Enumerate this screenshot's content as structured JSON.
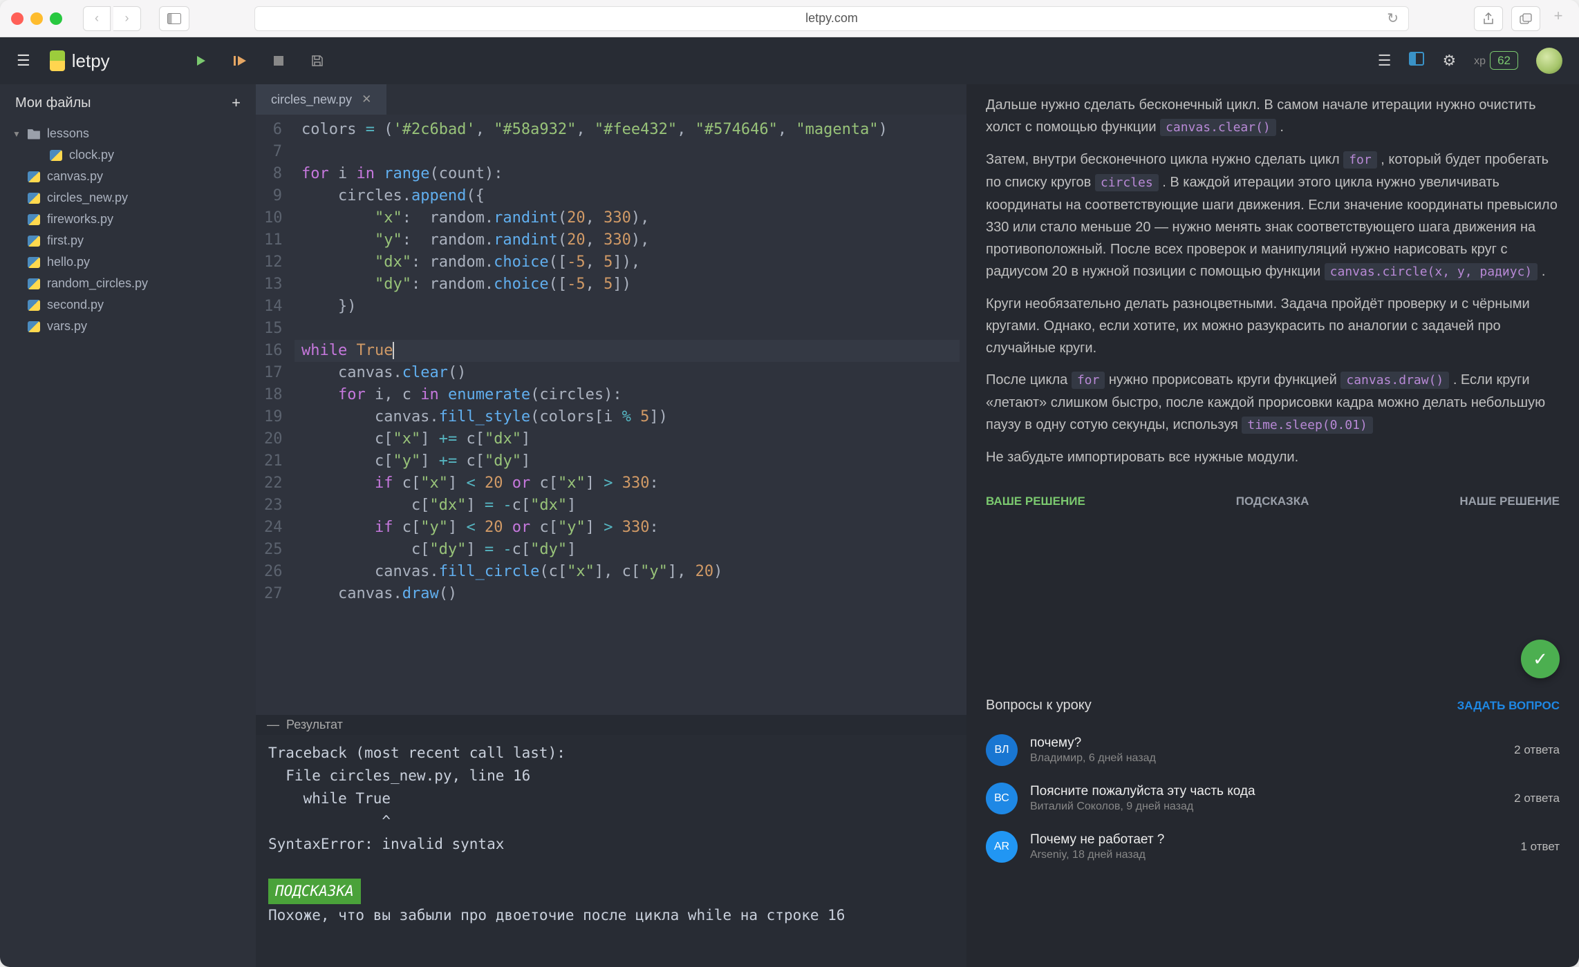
{
  "browser": {
    "url": "letpy.com"
  },
  "header": {
    "brand": "letpy",
    "xp_label": "xp",
    "xp_value": "62"
  },
  "filepanel": {
    "title": "Мои файлы",
    "folder": "lessons",
    "folder_child": "clock.py",
    "files": [
      "canvas.py",
      "circles_new.py",
      "fireworks.py",
      "first.py",
      "hello.py",
      "random_circles.py",
      "second.py",
      "vars.py"
    ]
  },
  "editor": {
    "tab_name": "circles_new.py",
    "gutter_start": 6,
    "lines": [
      {
        "n": 6,
        "html": "colors <span class='tk-op'>=</span> (<span class='tk-str'>'#2c6bad'</span>, <span class='tk-str'>\"#58a932\"</span>, <span class='tk-str'>\"#fee432\"</span>, <span class='tk-str'>\"#574646\"</span>, <span class='tk-str'>\"magenta\"</span>)"
      },
      {
        "n": 7,
        "html": ""
      },
      {
        "n": 8,
        "html": "<span class='tk-kw'>for</span> i <span class='tk-kw'>in</span> <span class='tk-fn'>range</span>(count):"
      },
      {
        "n": 9,
        "html": "    circles.<span class='tk-fn'>append</span>({"
      },
      {
        "n": 10,
        "html": "        <span class='tk-str'>\"x\"</span>:  random.<span class='tk-fn'>randint</span>(<span class='tk-num'>20</span>, <span class='tk-num'>330</span>),"
      },
      {
        "n": 11,
        "html": "        <span class='tk-str'>\"y\"</span>:  random.<span class='tk-fn'>randint</span>(<span class='tk-num'>20</span>, <span class='tk-num'>330</span>),"
      },
      {
        "n": 12,
        "html": "        <span class='tk-str'>\"dx\"</span>: random.<span class='tk-fn'>choice</span>([<span class='tk-num'>-5</span>, <span class='tk-num'>5</span>]),"
      },
      {
        "n": 13,
        "html": "        <span class='tk-str'>\"dy\"</span>: random.<span class='tk-fn'>choice</span>([<span class='tk-num'>-5</span>, <span class='tk-num'>5</span>])"
      },
      {
        "n": 14,
        "html": "    })"
      },
      {
        "n": 15,
        "html": ""
      },
      {
        "n": 16,
        "html": "<span class='tk-kw'>while</span> <span class='tk-const'>True</span><span class='cursor'></span>",
        "hl": true
      },
      {
        "n": 17,
        "html": "    canvas.<span class='tk-fn'>clear</span>()"
      },
      {
        "n": 18,
        "html": "    <span class='tk-kw'>for</span> i, c <span class='tk-kw'>in</span> <span class='tk-fn'>enumerate</span>(circles):"
      },
      {
        "n": 19,
        "html": "        canvas.<span class='tk-fn'>fill_style</span>(colors[i <span class='tk-op'>%</span> <span class='tk-num'>5</span>])"
      },
      {
        "n": 20,
        "html": "        c[<span class='tk-str'>\"x\"</span>] <span class='tk-op'>+=</span> c[<span class='tk-str'>\"dx\"</span>]"
      },
      {
        "n": 21,
        "html": "        c[<span class='tk-str'>\"y\"</span>] <span class='tk-op'>+=</span> c[<span class='tk-str'>\"dy\"</span>]"
      },
      {
        "n": 22,
        "html": "        <span class='tk-kw'>if</span> c[<span class='tk-str'>\"x\"</span>] <span class='tk-op'>&lt;</span> <span class='tk-num'>20</span> <span class='tk-kw'>or</span> c[<span class='tk-str'>\"x\"</span>] <span class='tk-op'>&gt;</span> <span class='tk-num'>330</span>:"
      },
      {
        "n": 23,
        "html": "            c[<span class='tk-str'>\"dx\"</span>] <span class='tk-op'>=</span> <span class='tk-op'>-</span>c[<span class='tk-str'>\"dx\"</span>]"
      },
      {
        "n": 24,
        "html": "        <span class='tk-kw'>if</span> c[<span class='tk-str'>\"y\"</span>] <span class='tk-op'>&lt;</span> <span class='tk-num'>20</span> <span class='tk-kw'>or</span> c[<span class='tk-str'>\"y\"</span>] <span class='tk-op'>&gt;</span> <span class='tk-num'>330</span>:"
      },
      {
        "n": 25,
        "html": "            c[<span class='tk-str'>\"dy\"</span>] <span class='tk-op'>=</span> <span class='tk-op'>-</span>c[<span class='tk-str'>\"dy\"</span>]"
      },
      {
        "n": 26,
        "html": "        canvas.<span class='tk-fn'>fill_circle</span>(c[<span class='tk-str'>\"x\"</span>], c[<span class='tk-str'>\"y\"</span>], <span class='tk-num'>20</span>)"
      },
      {
        "n": 27,
        "html": "    canvas.<span class='tk-fn'>draw</span>()"
      }
    ]
  },
  "result": {
    "label": "Результат",
    "traceback_l1": "Traceback (most recent call last):",
    "traceback_l2": "  File circles_new.py, line 16",
    "traceback_l3": "    while True",
    "traceback_l4": "             ^",
    "error": "SyntaxError: invalid syntax",
    "hint_label": "ПОДСКАЗКА",
    "hint_text": "Похоже, что вы забыли про двоеточие после цикла while на строке 16"
  },
  "instruction": {
    "p1_a": "Дальше нужно сделать бесконечный цикл. В самом начале итерации нужно очистить холст с помощью функции ",
    "p1_chip": "canvas.clear()",
    "p1_b": " .",
    "p2_a": "Затем, внутри бесконечного цикла нужно сделать цикл ",
    "p2_chip1": "for",
    "p2_b": " , который будет пробегать по списку кругов ",
    "p2_chip2": "circles",
    "p2_c": " . В каждой итерации этого цикла нужно увеличивать координаты на соответствующие шаги движения. Если значение координаты превысило 330 или стало меньше 20 — нужно менять знак соответствующего шага движения на противоположный. После всех проверок и манипуляций нужно нарисовать круг с радиусом 20 в нужной позиции с помощью функции ",
    "p2_chip3": "canvas.circle(x, y, радиус)",
    "p2_d": " .",
    "p3": "Круги необязательно делать разноцветными. Задача пройдёт проверку и с чёрными кругами. Однако, если хотите, их можно разукрасить по аналогии с задачей про случайные круги.",
    "p4_a": "После цикла ",
    "p4_chip1": "for",
    "p4_b": " нужно прорисовать круги функцией ",
    "p4_chip2": "canvas.draw()",
    "p4_c": " . Если круги «летают» слишком быстро, после каждой прорисовки кадра можно делать небольшую паузу в одну сотую секунды, используя ",
    "p4_chip3": "time.sleep(0.01)",
    "p5": "Не забудьте импортировать все нужные модули."
  },
  "solution_tabs": {
    "your": "ВАШЕ РЕШЕНИЕ",
    "hint": "ПОДСКАЗКА",
    "our": "НАШЕ РЕШЕНИЕ"
  },
  "questions": {
    "title": "Вопросы к уроку",
    "ask": "ЗАДАТЬ ВОПРОС",
    "items": [
      {
        "initials": "ВЛ",
        "color": "#1976d2",
        "subject": "почему?",
        "meta": "Владимир, 6 дней назад",
        "answers": "2 ответа"
      },
      {
        "initials": "ВС",
        "color": "#1e88e5",
        "subject": "Поясните пожалуйста эту часть кода",
        "meta": "Виталий Соколов, 9 дней назад",
        "answers": "2 ответа"
      },
      {
        "initials": "AR",
        "color": "#2196f3",
        "subject": "Почему не работает ?",
        "meta": "Arseniy, 18 дней назад",
        "answers": "1 ответ"
      }
    ]
  }
}
